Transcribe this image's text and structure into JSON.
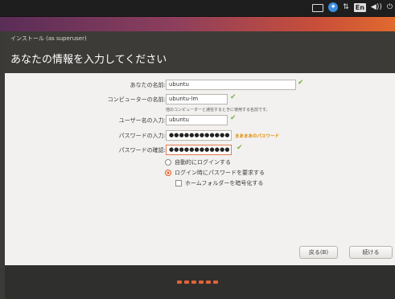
{
  "tray": {
    "icons": [
      "keyboard-icon",
      "accessibility-icon",
      "network-icon",
      "language-icon",
      "volume-icon",
      "power-icon"
    ],
    "language_label": "En"
  },
  "window": {
    "title": "インストール (as superuser)",
    "heading": "あなたの情報を入力してください"
  },
  "form": {
    "name_label": "あなたの名前:",
    "name_value": "ubuntu",
    "computer_label": "コンピューターの名前:",
    "computer_value": "ubuntu-lm",
    "computer_hint": "他のコンピューターと通信するときに使用する名前です。",
    "username_label": "ユーザー名の入力:",
    "username_value": "ubuntu",
    "password_label": "パスワードの入力:",
    "password_value": "●●●●●●●●●●●●",
    "password_strength": "まあまあのパスワード",
    "confirm_label": "パスワードの確認:",
    "confirm_value": "●●●●●●●●●●●●",
    "check_mark": "✔",
    "options": {
      "auto_login": "自動的にログインする",
      "require_password": "ログイン時にパスワードを要求する",
      "encrypt_home": "ホームフォルダーを暗号化する"
    },
    "selected_option": "require_password"
  },
  "buttons": {
    "back": "戻る(B)",
    "continue": "続ける"
  },
  "progress": {
    "step_count": 6
  },
  "colors": {
    "accent": "#e2591f",
    "check": "#7cb342",
    "strength": "#e08a00",
    "header_bg": "#3c3b37"
  }
}
